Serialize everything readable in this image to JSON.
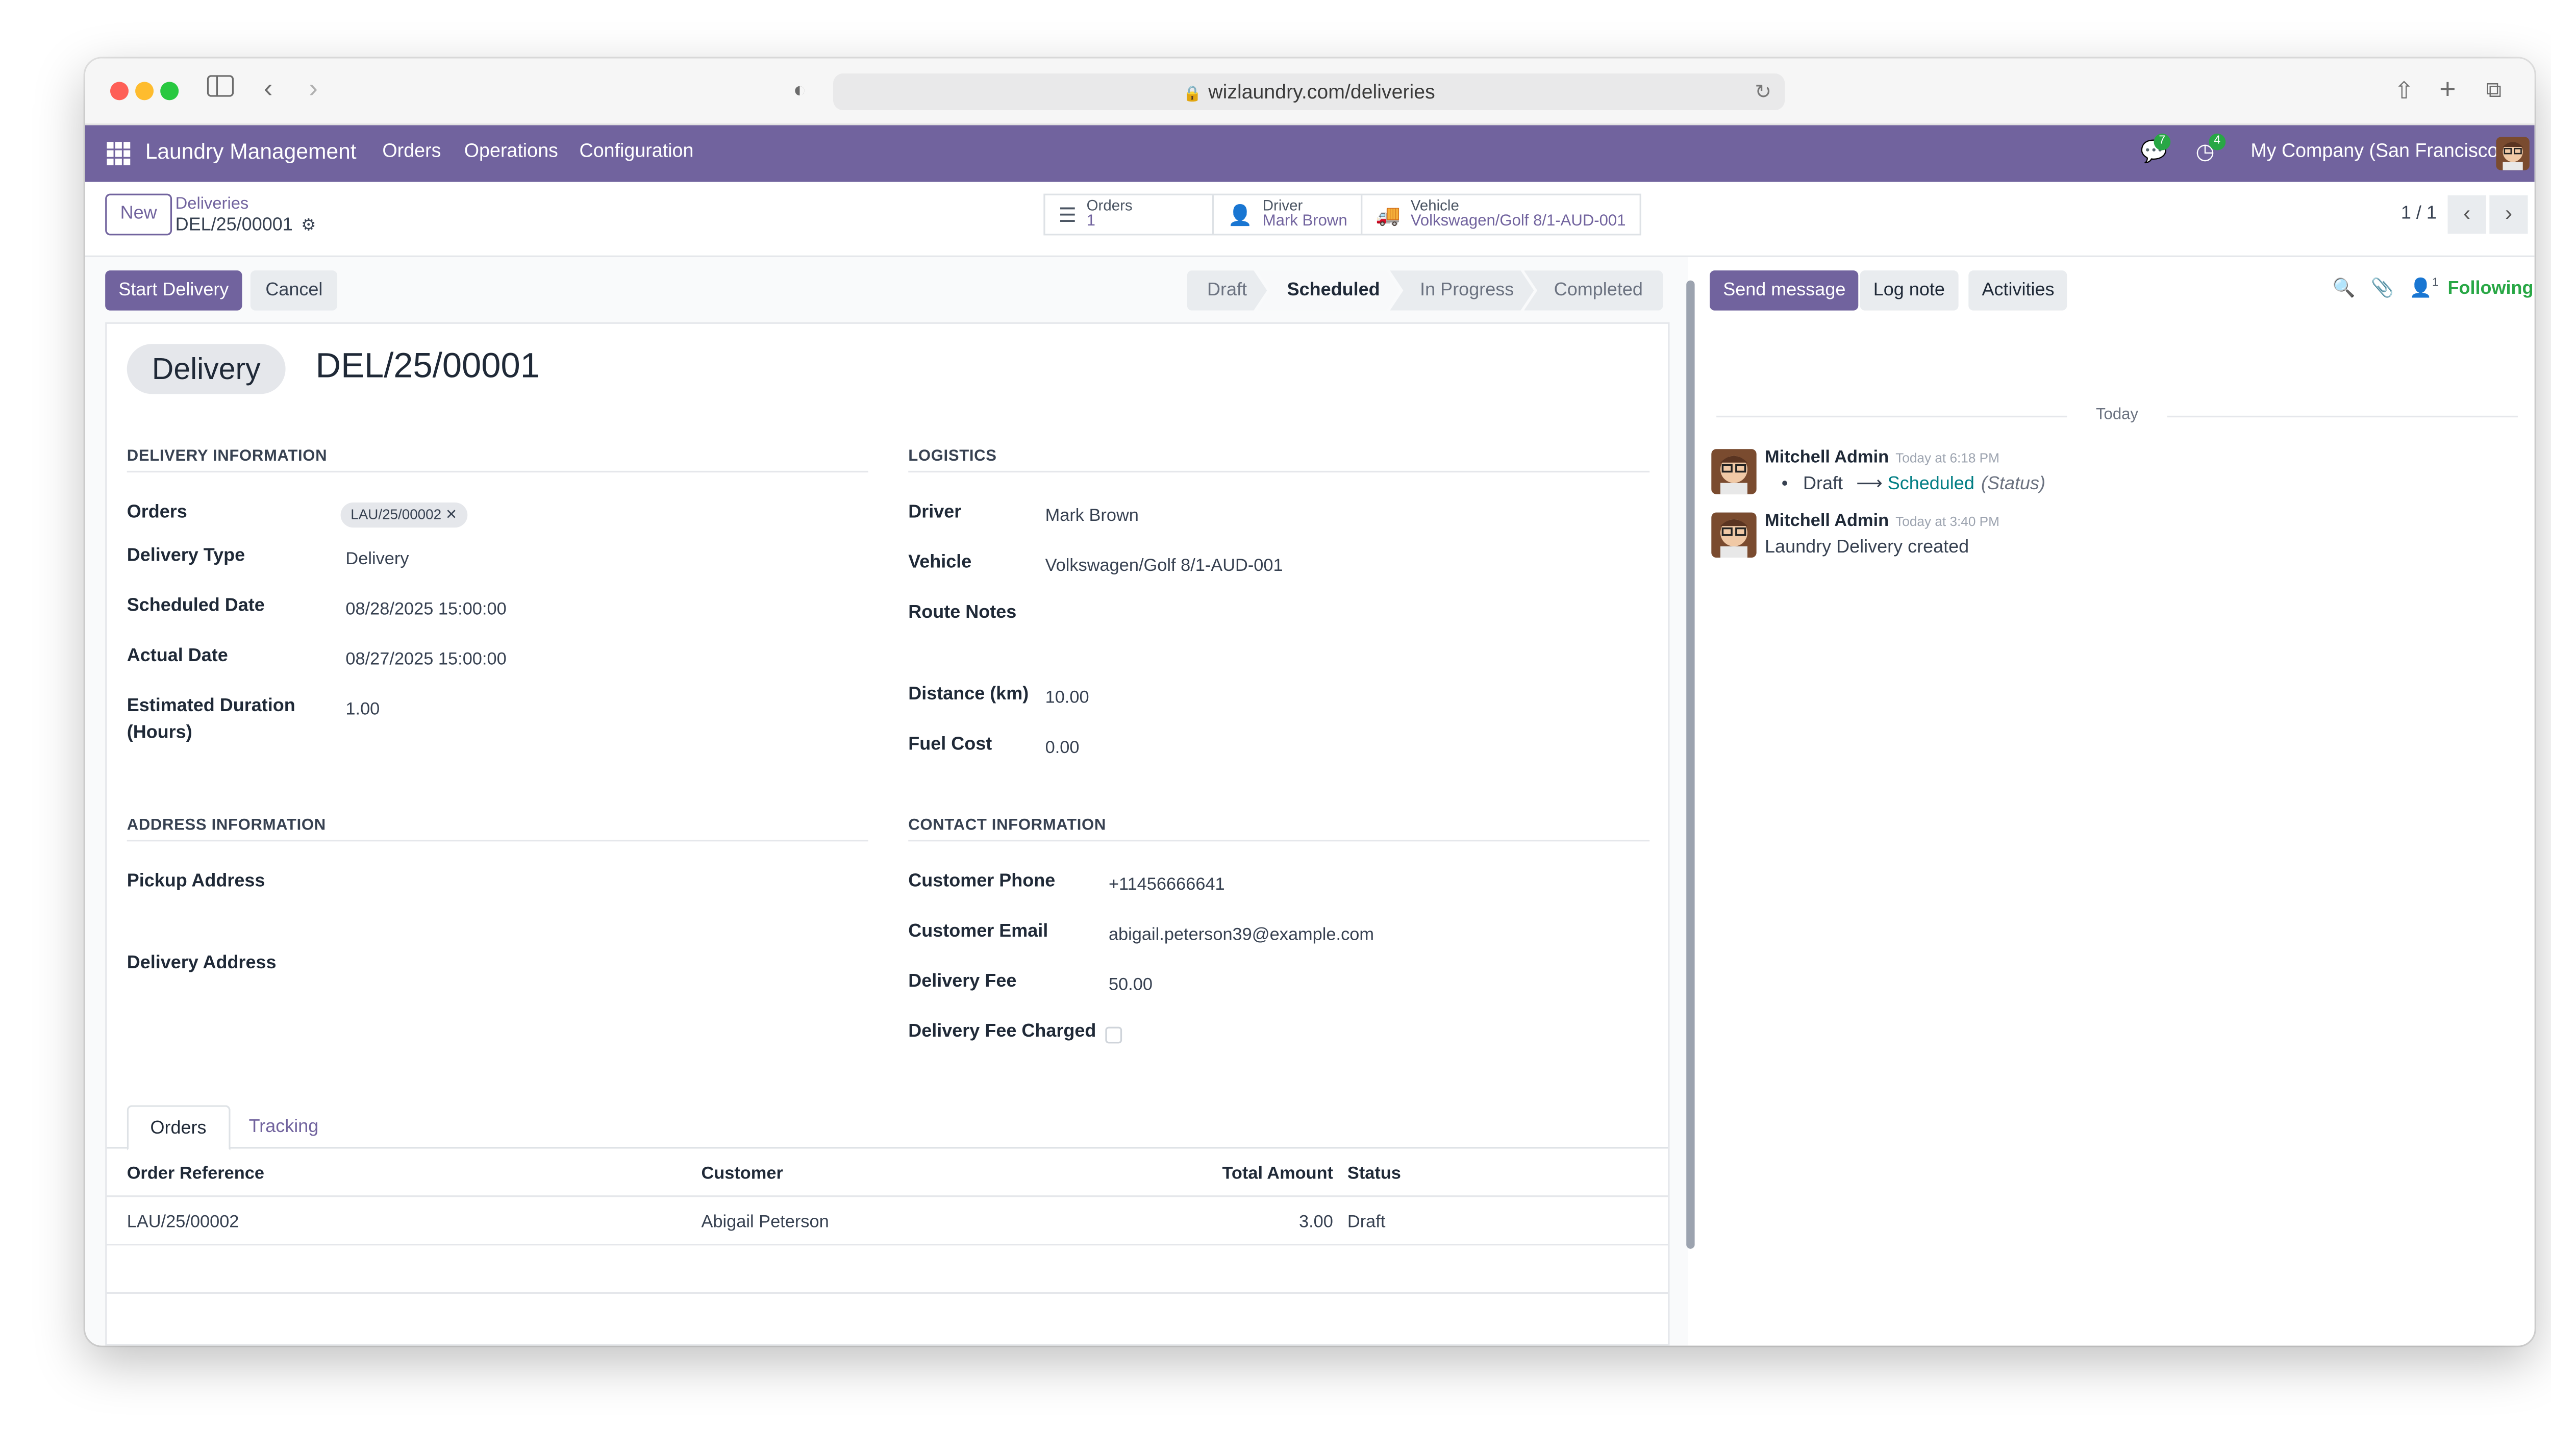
{
  "browser": {
    "url": "wizlaundry.com/deliveries"
  },
  "navbar": {
    "app_name": "Laundry Management",
    "menus": [
      "Orders",
      "Operations",
      "Configuration"
    ],
    "messages_badge": "7",
    "activities_badge": "4",
    "company": "My Company (San Francisco)"
  },
  "control_panel": {
    "new_label": "New",
    "breadcrumb_parent": "Deliveries",
    "breadcrumb_current": "DEL/25/00001",
    "smart_buttons": [
      {
        "title": "Orders",
        "value": "1",
        "icon": "list-icon"
      },
      {
        "title": "Driver",
        "value": "Mark Brown",
        "icon": "user-icon"
      },
      {
        "title": "Vehicle",
        "value": "Volkswagen/Golf 8/1-AUD-001",
        "icon": "truck-icon"
      }
    ],
    "pager": "1 / 1"
  },
  "actions": {
    "primary": "Start Delivery",
    "cancel": "Cancel"
  },
  "statusbar": {
    "stages": [
      "Draft",
      "Scheduled",
      "In Progress",
      "Completed"
    ],
    "active": "Scheduled"
  },
  "form": {
    "type_tag": "Delivery",
    "name": "DEL/25/00001",
    "delivery_info": {
      "heading": "DELIVERY INFORMATION",
      "orders_label": "Orders",
      "orders_tag": "LAU/25/00002",
      "delivery_type_label": "Delivery Type",
      "delivery_type": "Delivery",
      "scheduled_date_label": "Scheduled Date",
      "scheduled_date": "08/28/2025 15:00:00",
      "actual_date_label": "Actual Date",
      "actual_date": "08/27/2025 15:00:00",
      "duration_label_1": "Estimated Duration",
      "duration_label_2": "(Hours)",
      "duration": "1.00"
    },
    "logistics": {
      "heading": "LOGISTICS",
      "driver_label": "Driver",
      "driver": "Mark Brown",
      "vehicle_label": "Vehicle",
      "vehicle": "Volkswagen/Golf 8/1-AUD-001",
      "route_notes_label": "Route Notes",
      "distance_label": "Distance (km)",
      "distance": "10.00",
      "fuel_cost_label": "Fuel Cost",
      "fuel_cost": "0.00"
    },
    "address_info": {
      "heading": "ADDRESS INFORMATION",
      "pickup_label": "Pickup Address",
      "delivery_label": "Delivery Address"
    },
    "contact_info": {
      "heading": "CONTACT INFORMATION",
      "phone_label": "Customer Phone",
      "phone": "+11456666641",
      "email_label": "Customer Email",
      "email": "abigail.peterson39@example.com",
      "fee_label": "Delivery Fee",
      "fee": "50.00",
      "fee_charged_label": "Delivery Fee Charged",
      "fee_charged": false
    },
    "tabs": [
      "Orders",
      "Tracking"
    ],
    "orders_table": {
      "columns": [
        "Order Reference",
        "Customer",
        "Total Amount",
        "Status"
      ],
      "rows": [
        {
          "ref": "LAU/25/00002",
          "customer": "Abigail Peterson",
          "total": "3.00",
          "status": "Draft"
        }
      ]
    }
  },
  "chatter": {
    "send_message": "Send message",
    "log_note": "Log note",
    "activities": "Activities",
    "followers_count": "1",
    "following": "Following",
    "date_separator": "Today",
    "messages": [
      {
        "author": "Mitchell Admin",
        "time": "Today at 6:18 PM",
        "old": "Draft",
        "new": "Scheduled",
        "field": "(Status)"
      },
      {
        "author": "Mitchell Admin",
        "time": "Today at 3:40 PM",
        "body": "Laundry Delivery created"
      }
    ]
  }
}
